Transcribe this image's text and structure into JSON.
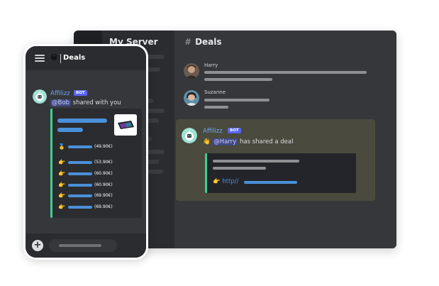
{
  "desktop": {
    "server_name": "My Server",
    "channel": {
      "hash": "#",
      "name": "Deals"
    },
    "messages": [
      {
        "author": "Harry"
      },
      {
        "author": "Suzanne"
      }
    ],
    "bot_message": {
      "author": "Affilizz",
      "badge": "BOT",
      "wave": "👋",
      "mention": "@Harry",
      "text": "has shared a deal",
      "link_icon": "👉",
      "link_text": "http//"
    }
  },
  "phone": {
    "channel_emoji": "😀",
    "channel_name": "Deals",
    "bot_message": {
      "author": "Affilizz",
      "badge": "BOT",
      "mention": "@Bob",
      "text": "shared with you"
    },
    "deals": [
      {
        "icon": "🥇",
        "price": "(49.90€)"
      },
      {
        "icon": "👉",
        "price": "(53.90€)"
      },
      {
        "icon": "👉",
        "price": "(60.90€)"
      },
      {
        "icon": "👉",
        "price": "(60.90€)"
      },
      {
        "icon": "👉",
        "price": "(69.90€)"
      },
      {
        "icon": "👉",
        "price": "(69.90€)"
      }
    ],
    "footer": {
      "plus_label": "+"
    }
  },
  "colors": {
    "accent_green": "#3ecf8e",
    "link_blue": "#4a90d9",
    "bot_badge": "#5865f2",
    "bot_name": "#6aa6f0"
  }
}
